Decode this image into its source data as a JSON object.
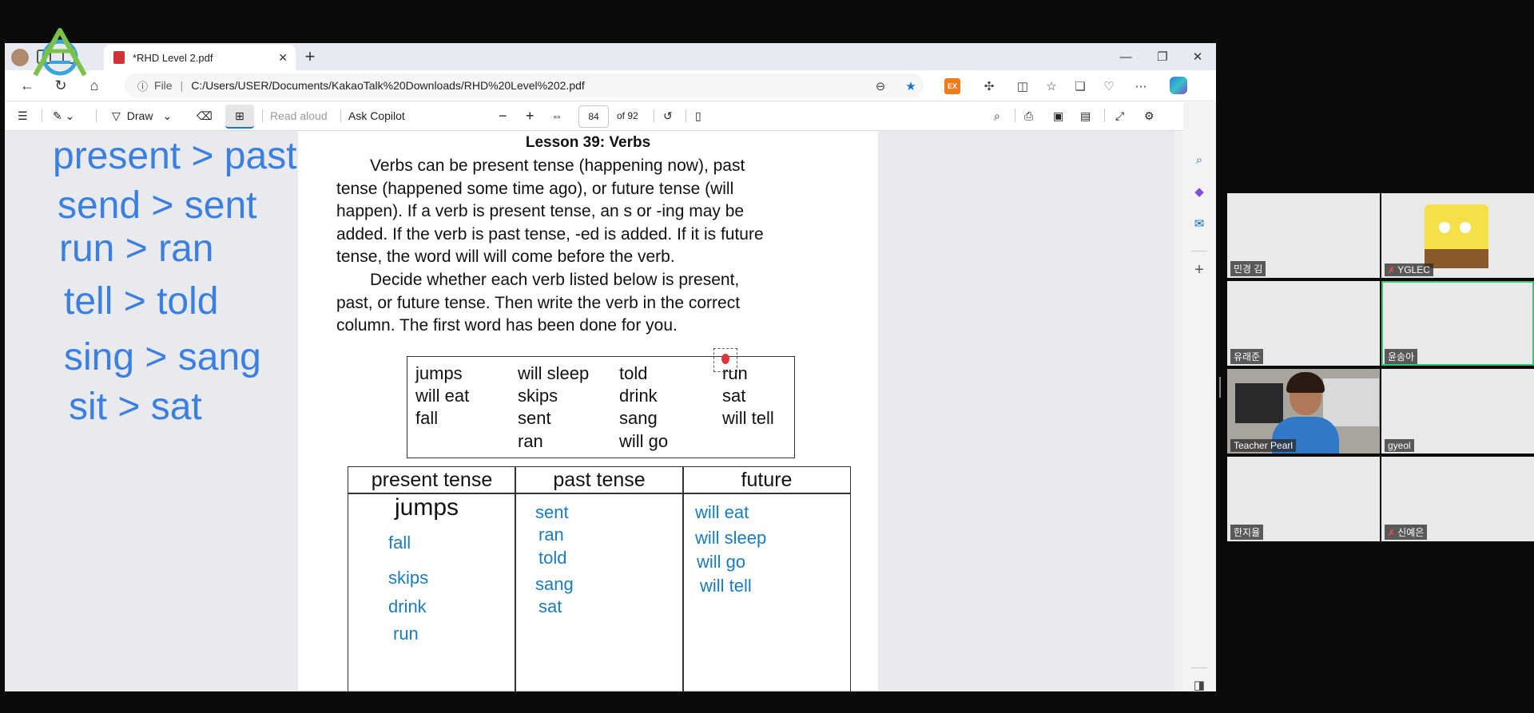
{
  "browser": {
    "tab_title": "*RHD Level 2.pdf",
    "tab_close": "✕",
    "new_tab": "+",
    "address": {
      "info_glyph": "ⓘ",
      "scheme_label": "File",
      "url": "C:/Users/USER/Documents/KakaoTalk%20Downloads/RHD%20Level%202.pdf"
    },
    "window_controls": [
      "—",
      "❐",
      "✕"
    ]
  },
  "pdf_toolbar": {
    "draw_label": "Draw",
    "read_aloud_label": "Read aloud",
    "ask_copilot_label": "Ask Copilot",
    "zoom_out": "−",
    "zoom_in": "+",
    "page_number": "84",
    "page_total": "of 92"
  },
  "annotations": {
    "lines": [
      "present > past",
      "send > sent",
      "run > ran",
      "tell > told",
      "sing > sang",
      "sit > sat"
    ]
  },
  "page": {
    "lesson_title": "Lesson 39: Verbs",
    "paragraph1_lines": [
      "Verbs can be present tense (happening now), past",
      "tense (happened some time ago), or future tense (will",
      "happen). If a verb is present tense, an s or -ing may be",
      "added. If the verb is past tense, -ed is added. If it is future",
      "tense, the word will will come before the verb."
    ],
    "paragraph2_lines": [
      "Decide whether each verb listed below is present,",
      "past, or future tense. Then write the verb in the correct",
      "column. The first word has been done for you."
    ],
    "word_box_columns": [
      [
        "jumps",
        "will eat",
        "fall"
      ],
      [
        "will sleep",
        "skips",
        "sent",
        "ran"
      ],
      [
        "told",
        "drink",
        "sang",
        "will go"
      ],
      [
        "run",
        "sat",
        "will tell"
      ]
    ],
    "answer_table": {
      "headers": [
        "present tense",
        "past tense",
        "future"
      ],
      "present_printed": "jumps",
      "present_written": [
        "fall",
        "skips",
        "drink",
        "run"
      ],
      "past_written": [
        "sent",
        "ran",
        "told",
        "sang",
        "sat"
      ],
      "future_written": [
        "will eat",
        "will sleep",
        "will go",
        "will tell"
      ]
    }
  },
  "participants": [
    {
      "name": "민경 김",
      "muted": false
    },
    {
      "name": "YGLEC",
      "muted": true
    },
    {
      "name": "유래준",
      "muted": false
    },
    {
      "name": "윤송아",
      "muted": false
    },
    {
      "name": "Teacher Pearl",
      "muted": false
    },
    {
      "name": "gyeol",
      "muted": false
    },
    {
      "name": "한지율",
      "muted": false
    },
    {
      "name": "신예은",
      "muted": true
    }
  ],
  "colors": {
    "annotation_blue": "#3b7fe0",
    "handwriting_blue": "#1a7bbf",
    "active_speaker_border": "#2ecc71"
  }
}
